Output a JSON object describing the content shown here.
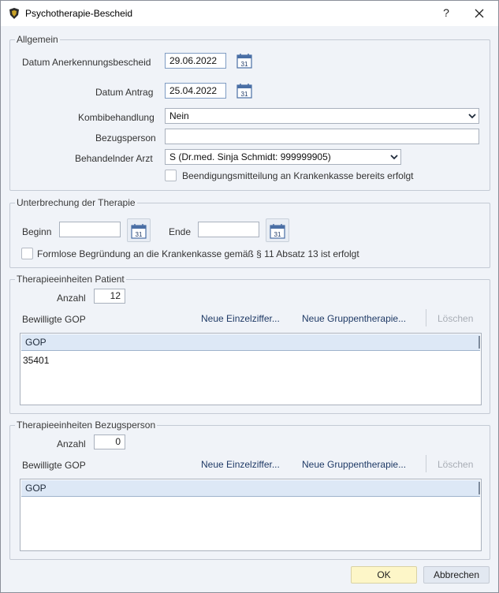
{
  "window": {
    "title": "Psychotherapie-Bescheid",
    "help": "?",
    "close": "×"
  },
  "allgemein": {
    "title": "Allgemein",
    "datum_anerkennung_label": "Datum Anerkennungsbescheid",
    "datum_anerkennung_value": "29.06.2022",
    "datum_antrag_label": "Datum Antrag",
    "datum_antrag_value": "25.04.2022",
    "kombi_label": "Kombibehandlung",
    "kombi_value": "Nein",
    "bezugsperson_label": "Bezugsperson",
    "bezugsperson_value": "",
    "arzt_label": "Behandelnder Arzt",
    "arzt_value": "S (Dr.med. Sinja Schmidt: 999999905)",
    "beendigung_label": "Beendigungsmitteilung an Krankenkasse bereits erfolgt",
    "beendigung_checked": false
  },
  "unterbrechung": {
    "title": "Unterbrechung der Therapie",
    "beginn_label": "Beginn",
    "beginn_value": "",
    "ende_label": "Ende",
    "ende_value": "",
    "formlos_label": "Formlose Begründung an die Krankenkasse gemäß § 11 Absatz 13 ist erfolgt",
    "formlos_checked": false
  },
  "patient": {
    "title": "Therapieeinheiten Patient",
    "anzahl_label": "Anzahl",
    "anzahl_value": "12",
    "gop_label": "Bewilligte GOP",
    "neue_einzel": "Neue Einzelziffer...",
    "neue_gruppe": "Neue Gruppentherapie...",
    "loeschen": "Löschen",
    "table": {
      "column": "GOP",
      "rows": [
        "35401"
      ]
    }
  },
  "bezug": {
    "title": "Therapieeinheiten Bezugsperson",
    "anzahl_label": "Anzahl",
    "anzahl_value": "0",
    "gop_label": "Bewilligte GOP",
    "neue_einzel": "Neue Einzelziffer...",
    "neue_gruppe": "Neue Gruppentherapie...",
    "loeschen": "Löschen",
    "table": {
      "column": "GOP",
      "rows": []
    }
  },
  "footer": {
    "ok": "OK",
    "cancel": "Abbrechen"
  },
  "calendar_icon_text": "31",
  "colors": {
    "ok_bg": "#fdf6c8",
    "header_bg": "#dde8f6",
    "link": "#1f3a66"
  }
}
